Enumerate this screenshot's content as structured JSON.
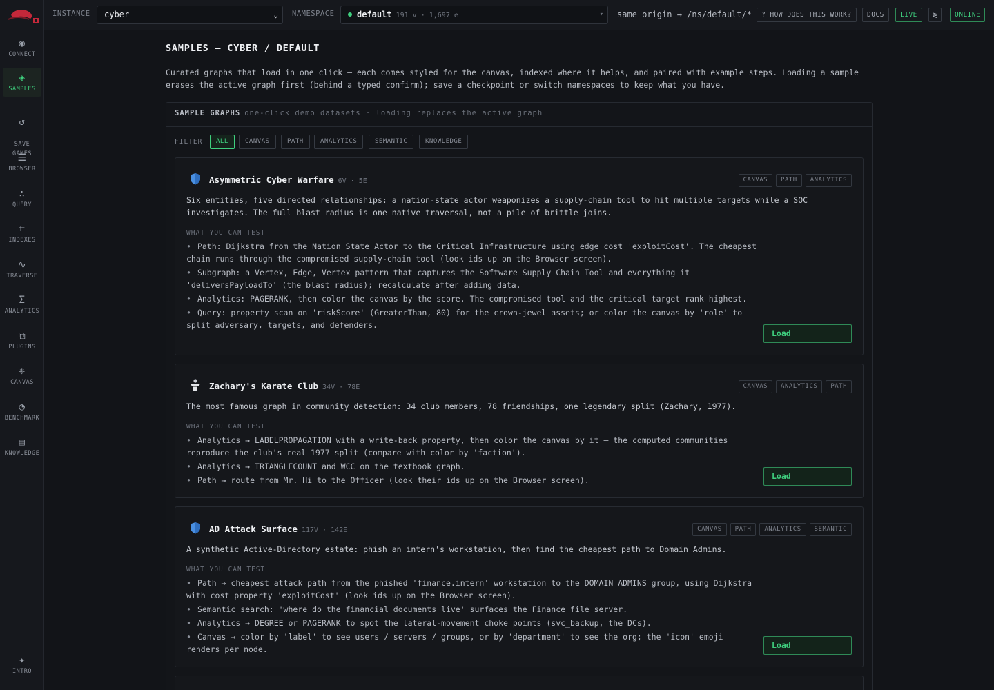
{
  "topbar": {
    "instance_label": "INSTANCE",
    "instance_value": "cyber",
    "namespace_label": "NAMESPACE",
    "namespace_name": "default",
    "namespace_meta": "191 v · 1,697 e",
    "origin": "same origin → /ns/default/*",
    "help_label": "? HOW DOES THIS WORK?",
    "docs_label": "DOCS",
    "live_label": "LIVE",
    "toggle_icon": "≷",
    "online_label": "ONLINE"
  },
  "sidebar": {
    "items": [
      {
        "label": "CONNECT",
        "icon": "◉"
      },
      {
        "label": "SAMPLES",
        "icon": "◈"
      },
      {
        "label": "SAVE\nGAMES",
        "icon": "↺"
      },
      {
        "label": "BROWSER",
        "icon": "☰"
      },
      {
        "label": "QUERY",
        "icon": "∴"
      },
      {
        "label": "INDEXES",
        "icon": "⌗"
      },
      {
        "label": "TRAVERSE",
        "icon": "∿"
      },
      {
        "label": "ANALYTICS",
        "icon": "Σ"
      },
      {
        "label": "PLUGINS",
        "icon": "⧉"
      },
      {
        "label": "CANVAS",
        "icon": "❈"
      },
      {
        "label": "BENCHMARK",
        "icon": "◔"
      },
      {
        "label": "KNOWLEDGE",
        "icon": "▤"
      },
      {
        "label": "INTRO",
        "icon": "✦"
      }
    ]
  },
  "page": {
    "title": "SAMPLES  — CYBER / DEFAULT",
    "intro": "Curated graphs that load in one click — each comes styled for the canvas, indexed where it helps, and paired with example steps. Loading a sample erases the active graph first (behind a typed confirm); save a checkpoint or switch namespaces to keep what you have."
  },
  "panel": {
    "heading": "SAMPLE GRAPHS",
    "subheading": "one-click demo datasets · loading replaces the active graph",
    "filter_label": "FILTER",
    "filters": [
      "ALL",
      "CANVAS",
      "PATH",
      "ANALYTICS",
      "SEMANTIC",
      "KNOWLEDGE"
    ]
  },
  "cards": [
    {
      "title": "Asymmetric Cyber Warfare",
      "meta": "6V · 5E",
      "icon": "shield-icon",
      "tags": [
        "CANVAS",
        "PATH",
        "ANALYTICS"
      ],
      "description": "Six entities, five directed relationships: a nation-state actor weaponizes a supply-chain tool to hit multiple targets while a SOC investigates. The full blast radius is one native traversal, not a pile of brittle joins.",
      "wyct": "WHAT YOU CAN TEST",
      "steps": [
        "Path: Dijkstra from the Nation State Actor to the Critical Infrastructure using edge cost 'exploitCost'. The cheapest chain runs through the compromised supply-chain tool (look ids up on the Browser screen).",
        "Subgraph: a Vertex, Edge, Vertex pattern that captures the Software Supply Chain Tool and everything it 'deliversPayloadTo' (the blast radius); recalculate after adding data.",
        "Analytics: PAGERANK, then color the canvas by the score. The compromised tool and the critical target rank highest.",
        "Query: property scan on 'riskScore' (GreaterThan, 80) for the crown-jewel assets; or color the canvas by 'role' to split adversary, targets, and defenders."
      ],
      "load_label": "Load"
    },
    {
      "title": "Zachary's Karate Club",
      "meta": "34V · 78E",
      "icon": "karate-icon",
      "tags": [
        "CANVAS",
        "ANALYTICS",
        "PATH"
      ],
      "description": "The most famous graph in community detection: 34 club members, 78 friendships, one legendary split (Zachary, 1977).",
      "wyct": "WHAT YOU CAN TEST",
      "steps": [
        "Analytics → LABELPROPAGATION with a write-back property, then color the canvas by it — the computed communities reproduce the club's real 1977 split (compare with color by 'faction').",
        "Analytics → TRIANGLECOUNT and WCC on the textbook graph.",
        "Path → route from Mr. Hi to the Officer (look their ids up on the Browser screen)."
      ],
      "load_label": "Load"
    },
    {
      "title": "AD Attack Surface",
      "meta": "117V · 142E",
      "icon": "shield-icon",
      "tags": [
        "CANVAS",
        "PATH",
        "ANALYTICS",
        "SEMANTIC"
      ],
      "description": "A synthetic Active-Directory estate: phish an intern's workstation, then find the cheapest path to Domain Admins.",
      "wyct": "WHAT YOU CAN TEST",
      "steps": [
        "Path → cheapest attack path from the phished 'finance.intern' workstation to the DOMAIN ADMINS group, using Dijkstra with cost property 'exploitCost' (look ids up on the Browser screen).",
        "Semantic search: 'where do the financial documents live' surfaces the Finance file server.",
        "Analytics → DEGREE or PAGERANK to spot the lateral-movement choke points (svc_backup, the DCs).",
        "Canvas → color by 'label' to see users / servers / groups, or by 'department' to see the org; the 'icon' emoji renders per node."
      ],
      "load_label": "Load"
    }
  ],
  "colors": {
    "accent": "#3fcf7e",
    "background": "#121418",
    "panel": "#16181d"
  }
}
